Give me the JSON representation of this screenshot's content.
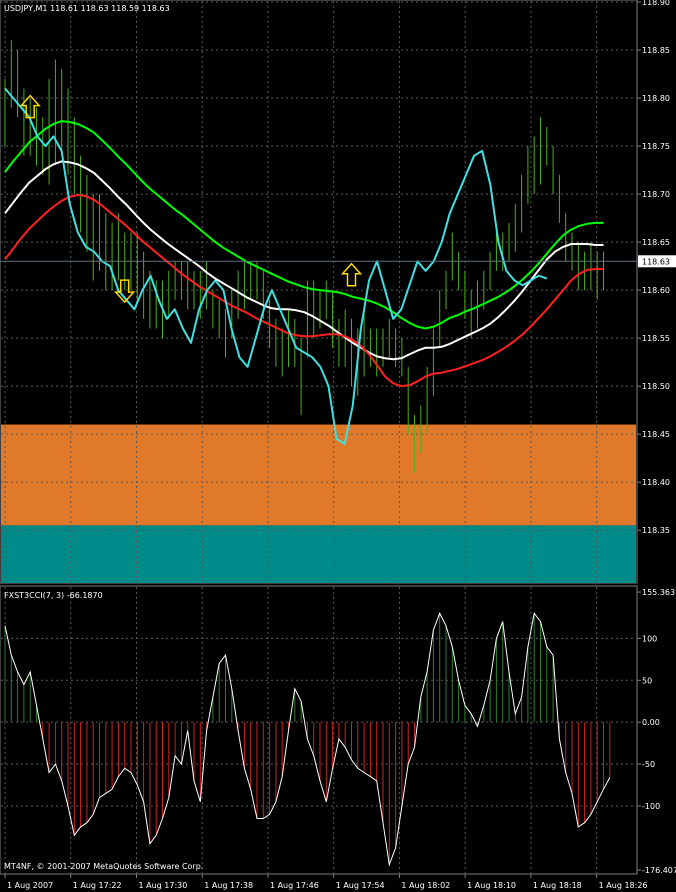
{
  "chart_data": [
    {
      "type": "line",
      "title": "USDJPY,M1 118.61 118.63 118.59 118.63",
      "ylim": [
        118.295,
        118.9
      ],
      "y_ticks": [
        118.35,
        118.4,
        118.45,
        118.5,
        118.55,
        118.6,
        118.65,
        118.7,
        118.75,
        118.8,
        118.85,
        118.9
      ],
      "y_tick_labels": [
        "118.35",
        "118.40",
        "118.45",
        "118.50",
        "118.55",
        "118.60",
        "118.65",
        "118.70",
        "118.75",
        "118.80",
        "118.85",
        "118.90"
      ],
      "current_price": 118.63,
      "current_price_label": "118.63",
      "bands": [
        {
          "from": 118.355,
          "to": 118.46,
          "color": "#E07A2A"
        },
        {
          "from": 118.295,
          "to": 118.355,
          "color": "#008B8B"
        }
      ],
      "bars": [
        [
          118.75,
          118.82
        ],
        [
          118.79,
          118.86
        ],
        [
          118.78,
          118.85
        ],
        [
          118.74,
          118.81
        ],
        [
          118.74,
          118.8
        ],
        [
          118.73,
          118.79
        ],
        [
          118.72,
          118.78
        ],
        [
          118.71,
          118.82
        ],
        [
          118.73,
          118.84
        ],
        [
          118.74,
          118.83
        ],
        [
          118.72,
          118.81
        ],
        [
          118.7,
          118.78
        ],
        [
          118.66,
          118.74
        ],
        [
          118.64,
          118.72
        ],
        [
          118.61,
          118.7
        ],
        [
          118.62,
          118.7
        ],
        [
          118.6,
          118.68
        ],
        [
          118.6,
          118.67
        ],
        [
          118.61,
          118.68
        ],
        [
          118.6,
          118.66
        ],
        [
          118.6,
          118.66
        ],
        [
          118.59,
          118.66
        ],
        [
          118.57,
          118.64
        ],
        [
          118.56,
          118.62
        ],
        [
          118.56,
          118.61
        ],
        [
          118.55,
          118.61
        ],
        [
          118.57,
          118.62
        ],
        [
          118.59,
          118.63
        ],
        [
          118.59,
          118.63
        ],
        [
          118.58,
          118.63
        ],
        [
          118.58,
          118.62
        ],
        [
          118.57,
          118.62
        ],
        [
          118.58,
          118.63
        ],
        [
          118.56,
          118.6
        ],
        [
          118.55,
          118.59
        ],
        [
          118.53,
          118.58
        ],
        [
          118.55,
          118.6
        ],
        [
          118.57,
          118.62
        ],
        [
          118.58,
          118.63
        ],
        [
          118.59,
          118.63
        ],
        [
          118.59,
          118.63
        ],
        [
          118.57,
          118.62
        ],
        [
          118.54,
          118.59
        ],
        [
          118.52,
          118.57
        ],
        [
          118.51,
          118.56
        ],
        [
          118.52,
          118.58
        ],
        [
          118.52,
          118.57
        ],
        [
          118.47,
          118.55
        ],
        [
          118.53,
          118.61
        ],
        [
          118.55,
          118.61
        ],
        [
          118.56,
          118.6
        ],
        [
          118.57,
          118.61
        ],
        [
          118.54,
          118.6
        ],
        [
          118.52,
          118.57
        ],
        [
          118.52,
          118.58
        ],
        [
          118.5,
          118.57
        ],
        [
          118.49,
          118.56
        ],
        [
          118.51,
          118.58
        ],
        [
          118.52,
          118.56
        ],
        [
          118.51,
          118.56
        ],
        [
          118.52,
          118.56
        ],
        [
          118.53,
          118.57
        ],
        [
          118.52,
          118.56
        ],
        [
          118.51,
          118.55
        ],
        [
          118.45,
          118.52
        ],
        [
          118.41,
          118.47
        ],
        [
          118.43,
          118.48
        ],
        [
          118.45,
          118.52
        ],
        [
          118.49,
          118.56
        ],
        [
          118.54,
          118.6
        ],
        [
          118.58,
          118.62
        ],
        [
          118.61,
          118.66
        ],
        [
          118.6,
          118.64
        ],
        [
          118.57,
          118.62
        ],
        [
          118.55,
          118.6
        ],
        [
          118.56,
          118.61
        ],
        [
          118.58,
          118.62
        ],
        [
          118.6,
          118.64
        ],
        [
          118.62,
          118.66
        ],
        [
          118.62,
          118.66
        ],
        [
          118.63,
          118.67
        ],
        [
          118.64,
          118.69
        ],
        [
          118.66,
          118.72
        ],
        [
          118.69,
          118.75
        ],
        [
          118.7,
          118.76
        ],
        [
          118.71,
          118.78
        ],
        [
          118.73,
          118.77
        ],
        [
          118.7,
          118.75
        ],
        [
          118.67,
          118.72
        ],
        [
          118.63,
          118.68
        ],
        [
          118.62,
          118.66
        ],
        [
          118.6,
          118.65
        ],
        [
          118.6,
          118.64
        ],
        [
          118.6,
          118.65
        ],
        [
          118.59,
          118.64
        ],
        [
          118.6,
          118.64
        ]
      ],
      "series": [
        {
          "color": "#00FF00",
          "values": [
            118.723,
            118.734,
            118.744,
            118.754,
            118.761,
            118.768,
            118.773,
            118.776,
            118.775,
            118.773,
            118.769,
            118.764,
            118.756,
            118.748,
            118.739,
            118.731,
            118.722,
            118.713,
            118.705,
            118.698,
            118.691,
            118.684,
            118.678,
            118.671,
            118.664,
            118.657,
            118.65,
            118.644,
            118.639,
            118.634,
            118.629,
            118.625,
            118.621,
            118.617,
            118.613,
            118.609,
            118.606,
            118.603,
            118.601,
            118.6,
            118.599,
            118.598,
            118.596,
            118.593,
            118.591,
            118.589,
            118.586,
            118.582,
            118.577,
            118.571,
            118.566,
            118.562,
            118.56,
            118.562,
            118.566,
            118.571,
            118.574,
            118.578,
            118.581,
            118.585,
            118.589,
            118.593,
            118.598,
            118.604,
            118.611,
            118.619,
            118.628,
            118.638,
            118.648,
            118.657,
            118.663,
            118.667,
            118.669,
            118.67,
            118.67
          ]
        },
        {
          "color": "#FFFFFF",
          "values": [
            118.68,
            118.691,
            118.702,
            118.712,
            118.719,
            118.726,
            118.731,
            118.734,
            118.733,
            118.731,
            118.727,
            118.722,
            118.714,
            118.706,
            118.697,
            118.689,
            118.68,
            118.671,
            118.663,
            118.656,
            118.649,
            118.643,
            118.637,
            118.631,
            118.625,
            118.618,
            118.612,
            118.607,
            118.602,
            118.597,
            118.592,
            118.588,
            118.584,
            118.581,
            118.58,
            118.58,
            118.579,
            118.577,
            118.573,
            118.568,
            118.563,
            118.557,
            118.551,
            118.545,
            118.54,
            118.535,
            118.531,
            118.529,
            118.528,
            118.529,
            118.533,
            118.537,
            118.54,
            118.54,
            118.541,
            118.544,
            118.548,
            118.552,
            118.556,
            118.56,
            118.565,
            118.572,
            118.58,
            118.589,
            118.599,
            118.61,
            118.621,
            118.632,
            118.64,
            118.645,
            118.648,
            118.648,
            118.648,
            118.647,
            118.647
          ]
        },
        {
          "color": "#FF2020",
          "values": [
            118.632,
            118.643,
            118.654,
            118.664,
            118.672,
            118.68,
            118.687,
            118.693,
            118.697,
            118.699,
            118.698,
            118.694,
            118.688,
            118.681,
            118.674,
            118.667,
            118.659,
            118.651,
            118.644,
            118.637,
            118.63,
            118.623,
            118.616,
            118.61,
            118.604,
            118.599,
            118.594,
            118.589,
            118.584,
            118.58,
            118.576,
            118.571,
            118.567,
            118.563,
            118.559,
            118.555,
            118.553,
            118.552,
            118.552,
            118.553,
            118.554,
            118.554,
            118.552,
            118.548,
            118.542,
            118.533,
            118.522,
            118.51,
            118.503,
            118.5,
            118.501,
            118.505,
            118.51,
            118.513,
            118.514,
            118.516,
            118.518,
            118.521,
            118.524,
            118.527,
            118.531,
            118.536,
            118.541,
            118.547,
            118.554,
            118.562,
            118.571,
            118.58,
            118.59,
            118.6,
            118.61,
            118.617,
            118.621,
            118.622,
            118.622
          ]
        },
        {
          "color": "#40E0E0",
          "values": [
            118.81,
            118.8,
            118.79,
            118.78,
            118.76,
            118.75,
            118.76,
            118.745,
            118.69,
            118.66,
            118.645,
            118.64,
            118.63,
            118.625,
            118.6,
            118.59,
            118.58,
            118.6,
            118.615,
            118.59,
            118.57,
            118.58,
            118.56,
            118.545,
            118.58,
            118.6,
            118.61,
            118.6,
            118.56,
            118.53,
            118.52,
            118.55,
            118.58,
            118.6,
            118.58,
            118.56,
            118.54,
            118.535,
            118.53,
            118.52,
            118.5,
            118.445,
            118.44,
            118.48,
            118.56,
            118.61,
            118.63,
            118.6,
            118.57,
            118.58,
            118.605,
            118.63,
            118.62,
            118.63,
            118.65,
            118.68,
            118.7,
            118.72,
            118.74,
            118.745,
            118.71,
            118.65,
            118.62,
            118.61,
            118.605,
            118.61,
            118.615,
            118.612
          ]
        }
      ],
      "arrows": [
        {
          "index": 4,
          "price": 118.79,
          "direction": "up"
        },
        {
          "index": 19,
          "price": 118.6,
          "direction": "down"
        },
        {
          "index": 55,
          "price": 118.615,
          "direction": "up"
        }
      ]
    },
    {
      "type": "bar",
      "title": "FXST3CCI(7, 3) -66.1870",
      "ylim": [
        -176.4077,
        155.3637
      ],
      "y_ticks": [
        155.3637,
        100,
        50,
        0,
        -50,
        -100,
        -176.4077
      ],
      "y_tick_labels": [
        "155.3637",
        "100",
        "50",
        "0.00",
        "-50",
        "-100",
        "-176.4077"
      ],
      "values": [
        115,
        80,
        60,
        45,
        60,
        20,
        -20,
        -60,
        -50,
        -70,
        -100,
        -135,
        -125,
        -120,
        -110,
        -90,
        -85,
        -80,
        -65,
        -55,
        -60,
        -75,
        -95,
        -145,
        -135,
        -115,
        -90,
        -40,
        -50,
        -10,
        -70,
        -95,
        -10,
        30,
        70,
        80,
        40,
        -10,
        -55,
        -80,
        -115,
        -115,
        -110,
        -95,
        -65,
        -10,
        40,
        25,
        -20,
        -40,
        -70,
        -95,
        -55,
        -20,
        -30,
        -45,
        -55,
        -60,
        -65,
        -70,
        -120,
        -170,
        -150,
        -100,
        -50,
        -30,
        30,
        60,
        110,
        130,
        115,
        90,
        50,
        20,
        10,
        -5,
        20,
        50,
        100,
        120,
        60,
        10,
        30,
        90,
        130,
        120,
        90,
        80,
        -20,
        -60,
        -85,
        -125,
        -120,
        -110,
        -95,
        -80,
        -66
      ],
      "up_color": "#2E7D32",
      "down_color": "#CC2222",
      "x_tick_labels": [
        "1 Aug 2007",
        "1 Aug 17:22",
        "1 Aug 17:30",
        "1 Aug 17:38",
        "1 Aug 17:46",
        "1 Aug 17:54",
        "1 Aug 18:02",
        "1 Aug 18:10",
        "1 Aug 18:18",
        "1 Aug 18:26"
      ]
    }
  ],
  "footer": {
    "copyright": "MT4NF, © 2001-2007 MetaQuotes Software Corp."
  }
}
